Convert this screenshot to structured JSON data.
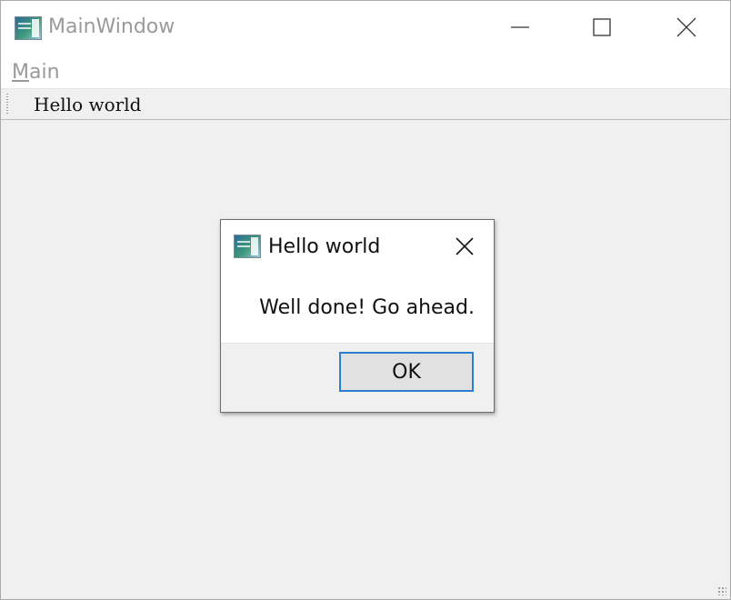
{
  "main_window": {
    "title": "MainWindow",
    "icon": "app-window-icon",
    "controls": {
      "minimize_icon": "minimize-icon",
      "maximize_icon": "maximize-icon",
      "close_icon": "close-icon"
    }
  },
  "menubar": {
    "items": [
      {
        "mnemonic": "M",
        "rest": "ain"
      }
    ]
  },
  "toolbar": {
    "button_label": "Hello world"
  },
  "dialog": {
    "title": "Hello world",
    "icon": "app-window-icon",
    "message": "Well done! Go ahead.",
    "ok_label": "OK",
    "close_icon": "close-icon"
  },
  "colors": {
    "accent": "#2c7fcf",
    "disabled_text": "#9a9a9a",
    "background": "#f0f0f0"
  }
}
